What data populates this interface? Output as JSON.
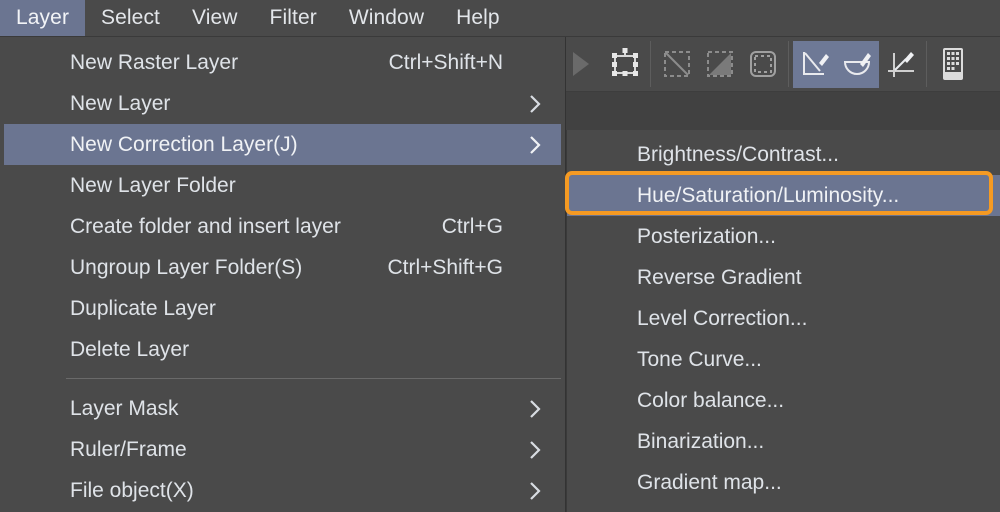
{
  "menubar": {
    "items": [
      {
        "label": "Layer",
        "active": true
      },
      {
        "label": "Select",
        "active": false
      },
      {
        "label": "View",
        "active": false
      },
      {
        "label": "Filter",
        "active": false
      },
      {
        "label": "Window",
        "active": false
      },
      {
        "label": "Help",
        "active": false
      }
    ]
  },
  "toolbar": {
    "tools": [
      {
        "icon": "play-triangle-icon",
        "active": false
      },
      {
        "icon": "transform-box-icon",
        "active": false
      },
      {
        "icon": "selection-diagonal-icon",
        "active": false
      },
      {
        "icon": "selection-fill-icon",
        "active": false
      },
      {
        "icon": "selection-rounded-icon",
        "active": false
      },
      {
        "icon": "fill-corner-brush-icon",
        "active": true
      },
      {
        "icon": "fill-bowl-brush-icon",
        "active": true
      },
      {
        "icon": "fill-line-brush-icon",
        "active": false
      },
      {
        "icon": "keypad-grid-icon",
        "active": false
      }
    ]
  },
  "layer_menu": {
    "rows": [
      {
        "label": "New Raster Layer",
        "accel": "Ctrl+Shift+N",
        "arrow": false,
        "highlighted": false
      },
      {
        "label": "New Layer",
        "accel": "",
        "arrow": true,
        "highlighted": false
      },
      {
        "label": "New Correction Layer(J)",
        "accel": "",
        "arrow": true,
        "highlighted": true
      },
      {
        "label": "New Layer Folder",
        "accel": "",
        "arrow": false,
        "highlighted": false
      },
      {
        "label": "Create folder and insert layer",
        "accel": "Ctrl+G",
        "arrow": false,
        "highlighted": false
      },
      {
        "label": "Ungroup Layer Folder(S)",
        "accel": "Ctrl+Shift+G",
        "arrow": false,
        "highlighted": false
      },
      {
        "label": "Duplicate Layer",
        "accel": "",
        "arrow": false,
        "highlighted": false
      },
      {
        "label": "Delete Layer",
        "accel": "",
        "arrow": false,
        "highlighted": false
      },
      {
        "separator": true
      },
      {
        "label": "Layer Mask",
        "accel": "",
        "arrow": true,
        "highlighted": false
      },
      {
        "label": "Ruler/Frame",
        "accel": "",
        "arrow": true,
        "highlighted": false
      },
      {
        "label": "File object(X)",
        "accel": "",
        "arrow": true,
        "highlighted": false
      }
    ]
  },
  "correction_submenu": {
    "rows": [
      {
        "label": "Brightness/Contrast...",
        "highlighted": false
      },
      {
        "label": "Hue/Saturation/Luminosity...",
        "highlighted": true
      },
      {
        "label": "Posterization...",
        "highlighted": false
      },
      {
        "label": "Reverse Gradient",
        "highlighted": false
      },
      {
        "label": "Level Correction...",
        "highlighted": false
      },
      {
        "label": "Tone Curve...",
        "highlighted": false
      },
      {
        "label": "Color balance...",
        "highlighted": false
      },
      {
        "label": "Binarization...",
        "highlighted": false
      },
      {
        "label": "Gradient map...",
        "highlighted": false
      }
    ]
  },
  "annotation": {
    "target": "Hue/Saturation/Luminosity...",
    "color": "#f59a23"
  },
  "colors": {
    "window_bg": "#454545",
    "menu_bg": "#4a4a4a",
    "highlight": "#6b7591",
    "text": "#dfe3e8",
    "accent": "#f59a23"
  }
}
